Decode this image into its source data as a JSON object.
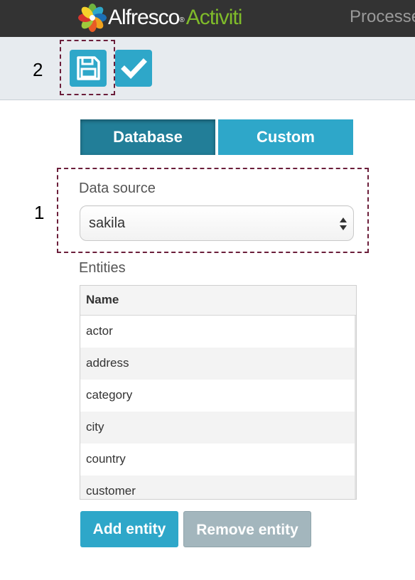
{
  "navbar": {
    "brand_primary": "Alfresco",
    "brand_registered": "®",
    "brand_secondary": "Activiti",
    "nav_link": "Processes",
    "logo_icon": "alfresco-flower-icon"
  },
  "toolbar": {
    "callout_number": "2",
    "save_icon": "floppy-disk-icon",
    "check_icon": "checkmark-icon"
  },
  "tabs": [
    {
      "label": "Database",
      "active": true
    },
    {
      "label": "Custom",
      "active": false
    }
  ],
  "form": {
    "callout_number": "1",
    "data_source_label": "Data source",
    "data_source_value": "sakila",
    "entities_label": "Entities"
  },
  "entities_table": {
    "header": "Name",
    "rows": [
      "actor",
      "address",
      "category",
      "city",
      "country",
      "customer"
    ]
  },
  "buttons": {
    "add_entity": "Add entity",
    "remove_entity": "Remove entity"
  },
  "colors": {
    "navbar_bg": "#333333",
    "brand_green": "#7fbb2a",
    "accent": "#2ea7c9",
    "accent_dark": "#227e98",
    "disabled": "#a3b6bd",
    "callout": "#6b1e3a"
  }
}
